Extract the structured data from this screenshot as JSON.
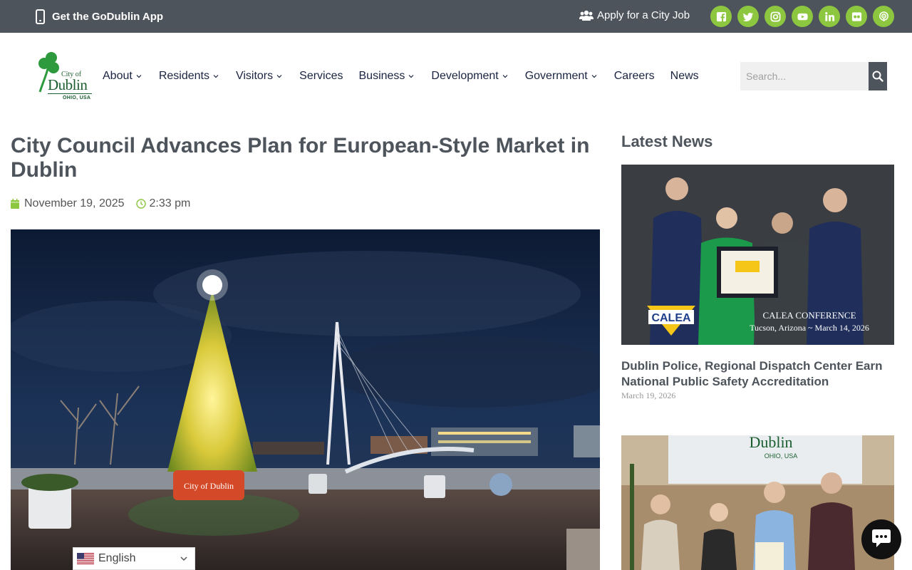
{
  "topbar": {
    "app_label": "Get the GoDublin App",
    "job_label": "Apply for a City Job",
    "social": [
      "facebook-icon",
      "twitter-icon",
      "instagram-icon",
      "youtube-icon",
      "linkedin-icon",
      "flickr-icon",
      "podcast-icon"
    ]
  },
  "logo": {
    "city_of": "City of",
    "dublin": "Dublin",
    "ohio": "OHIO, USA"
  },
  "nav": {
    "items": [
      {
        "label": "About",
        "dropdown": true
      },
      {
        "label": "Residents",
        "dropdown": true
      },
      {
        "label": "Visitors",
        "dropdown": true
      },
      {
        "label": "Services",
        "dropdown": false
      },
      {
        "label": "Business",
        "dropdown": true
      },
      {
        "label": "Development",
        "dropdown": true
      },
      {
        "label": "Government",
        "dropdown": true
      },
      {
        "label": "Careers",
        "dropdown": false
      },
      {
        "label": "News",
        "dropdown": false
      }
    ]
  },
  "search": {
    "placeholder": "Search..."
  },
  "article": {
    "title": "City Council Advances Plan for European-Style Market in Dublin",
    "date": "November 19, 2025",
    "time": "2:33 pm",
    "planter_text": "City of Dublin"
  },
  "translate": {
    "language": "English"
  },
  "sidebar": {
    "heading": "Latest News",
    "news": [
      {
        "title": "Dublin Police, Regional Dispatch Center Earn National Public Safety Accreditation",
        "date": "March 19, 2026",
        "image_caption_line1": "CALEA CONFERENCE",
        "image_caption_line2": "Tucson, Arizona ~ March 14, 2026",
        "badge": "CALEA"
      },
      {
        "image_text_dublin": "Dublin",
        "image_text_ohio": "OHIO, USA"
      }
    ]
  },
  "colors": {
    "topbar": "#4d545b",
    "accent_green": "#8dc63f",
    "heading": "#4d545b",
    "nav_text": "#1a2440"
  }
}
